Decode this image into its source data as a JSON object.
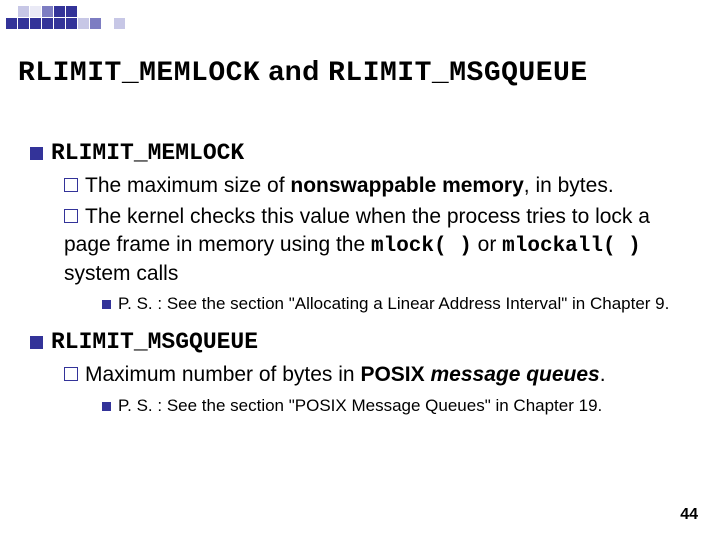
{
  "title": {
    "part1": "RLIMIT_MEMLOCK",
    "conj": " and ",
    "part2": "RLIMIT_MSGQUEUE"
  },
  "sections": [
    {
      "heading": "RLIMIT_MEMLOCK",
      "bullets": [
        {
          "prefix": "The maximum size of ",
          "bold": "nonswappable memory",
          "suffix": ", in bytes."
        },
        {
          "prefix": "The kernel checks this value when the process tries to lock a page frame in memory using the ",
          "code1": "mlock( )",
          "mid": " or ",
          "code2": "mlockall( )",
          "suffix": " system calls"
        }
      ],
      "subnote": "P. S. : See the section \"Allocating a Linear Address Interval\" in Chapter 9."
    },
    {
      "heading": "RLIMIT_MSGQUEUE",
      "bullets": [
        {
          "prefix": "Maximum number of bytes in ",
          "bold": "POSIX",
          "mid": " ",
          "bolditalic": "message queues",
          "suffix": "."
        }
      ],
      "subnote": "P. S. : See the section \"POSIX Message Queues\" in Chapter 19."
    }
  ],
  "page_number": "44"
}
